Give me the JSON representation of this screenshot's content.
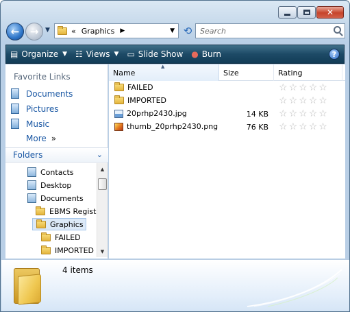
{
  "nav": {
    "address_chevron": "«",
    "address_segment": "Graphics",
    "search_placeholder": "Search"
  },
  "toolbar": {
    "organize": "Organize",
    "views": "Views",
    "slideshow": "Slide Show",
    "burn": "Burn",
    "help": "?"
  },
  "sidebar": {
    "favorites_title": "Favorite Links",
    "favorites": [
      {
        "label": "Documents"
      },
      {
        "label": "Pictures"
      },
      {
        "label": "Music"
      },
      {
        "label": "More"
      }
    ],
    "folders_title": "Folders",
    "tree": [
      {
        "label": "Contacts"
      },
      {
        "label": "Desktop"
      },
      {
        "label": "Documents"
      },
      {
        "label": "EBMS Registr"
      },
      {
        "label": "Graphics"
      },
      {
        "label": "FAILED"
      },
      {
        "label": "IMPORTED"
      }
    ]
  },
  "columns": {
    "name": "Name",
    "size": "Size",
    "rating": "Rating"
  },
  "files": [
    {
      "name": "FAILED",
      "size": "",
      "type": "folder",
      "rating": 0
    },
    {
      "name": "IMPORTED",
      "size": "",
      "type": "folder",
      "rating": 0
    },
    {
      "name": "20prhp2430.jpg",
      "size": "14 KB",
      "type": "jpg",
      "rating": 0
    },
    {
      "name": "thumb_20prhp2430.png",
      "size": "76 KB",
      "type": "png",
      "rating": 0
    }
  ],
  "details": {
    "item_count": "4 items"
  }
}
